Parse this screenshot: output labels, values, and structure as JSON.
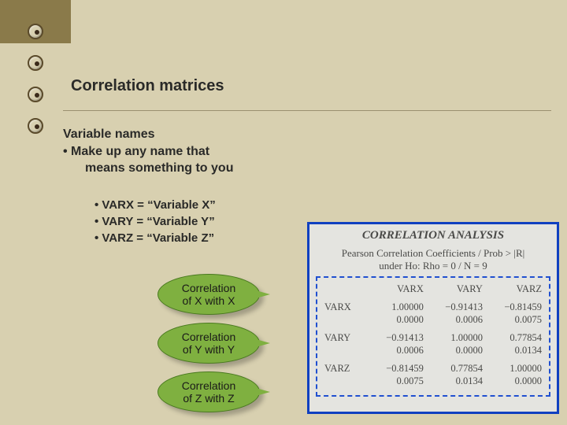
{
  "title": "Correlation matrices",
  "section": {
    "heading": "Variable names",
    "bullet": "• Make up any name that",
    "bullet_cont": "means something to you"
  },
  "vars": {
    "l1": "• VARX = “Variable X”",
    "l2": "• VARY = “Variable Y”",
    "l3": "• VARZ = “Variable Z”"
  },
  "callouts": {
    "c1a": "Correlation",
    "c1b": "of X with X",
    "c2a": "Correlation",
    "c2b": "of Y with Y",
    "c3a": "Correlation",
    "c3b": "of Z with Z"
  },
  "analysis": {
    "heading": "CORRELATION ANALYSIS",
    "sub1": "Pearson Correlation Coefficients / Prob > |R|",
    "sub2": "under Ho: Rho = 0 / N = 9",
    "headers": {
      "v1": "VARX",
      "v2": "VARY",
      "v3": "VARZ"
    },
    "rows": [
      {
        "name": "VARX",
        "c1": "1.00000",
        "p1": "0.0000",
        "c2": "−0.91413",
        "p2": "0.0006",
        "c3": "−0.81459",
        "p3": "0.0075"
      },
      {
        "name": "VARY",
        "c1": "−0.91413",
        "p1": "0.0006",
        "c2": "1.00000",
        "p2": "0.0000",
        "c3": "0.77854",
        "p3": "0.0134"
      },
      {
        "name": "VARZ",
        "c1": "−0.81459",
        "p1": "0.0075",
        "c2": "0.77854",
        "p2": "0.0134",
        "c3": "1.00000",
        "p3": "0.0000"
      }
    ]
  }
}
